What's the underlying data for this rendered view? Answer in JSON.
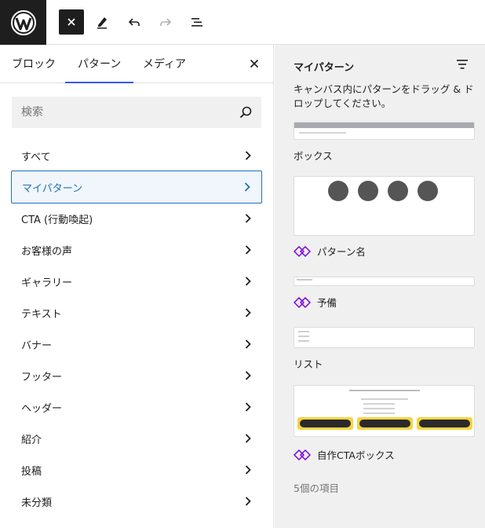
{
  "toolbar": {
    "logo_icon": "wordpress-logo-icon",
    "icons": [
      "close-icon",
      "pencil-icon",
      "undo-icon",
      "redo-icon",
      "list-view-icon"
    ]
  },
  "inserter": {
    "tabs": [
      {
        "label": "ブロック",
        "active": false
      },
      {
        "label": "パターン",
        "active": true
      },
      {
        "label": "メディア",
        "active": false
      }
    ],
    "search": {
      "placeholder": "検索",
      "value": ""
    },
    "categories": [
      {
        "label": "すべて",
        "selected": false
      },
      {
        "label": "マイパターン",
        "selected": true
      },
      {
        "label": "CTA (行動喚起)",
        "selected": false
      },
      {
        "label": "お客様の声",
        "selected": false
      },
      {
        "label": "ギャラリー",
        "selected": false
      },
      {
        "label": "テキスト",
        "selected": false
      },
      {
        "label": "バナー",
        "selected": false
      },
      {
        "label": "フッター",
        "selected": false
      },
      {
        "label": "ヘッダー",
        "selected": false
      },
      {
        "label": "紹介",
        "selected": false
      },
      {
        "label": "投稿",
        "selected": false
      },
      {
        "label": "未分類",
        "selected": false
      }
    ]
  },
  "patterns_panel": {
    "title": "マイパターン",
    "description": "キャンバス内にパターンをドラッグ & ドロップしてください。",
    "patterns": [
      {
        "name": "ボックス",
        "synced": false
      },
      {
        "name": "パターン名",
        "synced": true
      },
      {
        "name": "予備",
        "synced": true
      },
      {
        "name": "リスト",
        "synced": false
      },
      {
        "name": "自作CTAボックス",
        "synced": true
      }
    ],
    "count": "5個の項目",
    "accent_color": "#7a00df"
  }
}
